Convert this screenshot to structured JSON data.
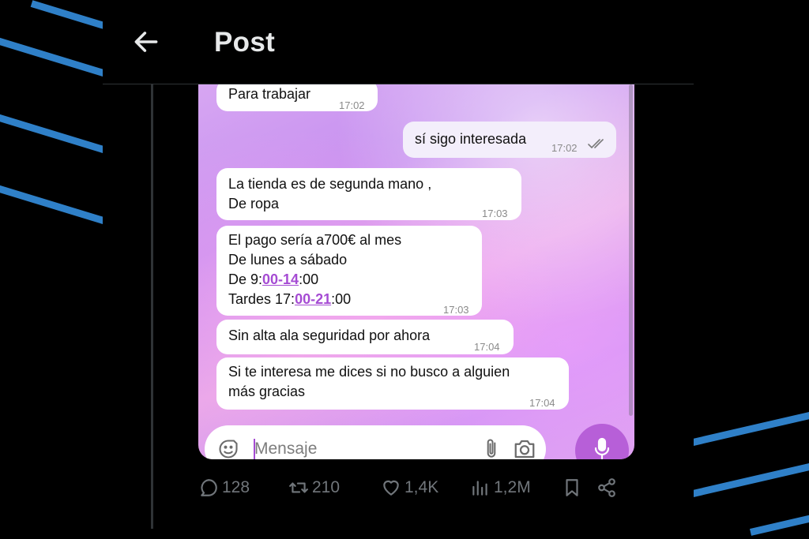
{
  "header": {
    "title": "Post",
    "back_icon": "arrow-left-icon"
  },
  "chat": {
    "messages": [
      {
        "text": "Para trabajar",
        "time": "17:02",
        "direction": "incoming"
      },
      {
        "text": "sí sigo interesada",
        "time": "17:02",
        "direction": "outgoing",
        "status": "read"
      },
      {
        "lines": [
          "La tienda es de  segunda mano ,",
          "De ropa"
        ],
        "time": "17:03",
        "direction": "incoming"
      },
      {
        "lines": [
          "El pago sería a700€ al mes",
          "De lunes a sábado"
        ],
        "schedule": [
          {
            "prefix": "De 9:",
            "link1": "00-14",
            "suffix": ":00"
          },
          {
            "prefix": "Tardes 17:",
            "link1": "00-21",
            "suffix": ":00"
          }
        ],
        "time": "17:03",
        "direction": "incoming"
      },
      {
        "text": "Sin alta ala seguridad por ahora",
        "time": "17:04",
        "direction": "incoming"
      },
      {
        "lines": [
          "Si te interesa me dices si no busco a alguien",
          "más gracias"
        ],
        "time": "17:04",
        "direction": "incoming"
      }
    ],
    "input_placeholder": "Mensaje",
    "accent_color": "#b75fd8"
  },
  "actions": {
    "replies": "128",
    "reposts": "210",
    "likes": "1,4K",
    "views": "1,2M"
  },
  "colors": {
    "background": "#000000",
    "stripes": "#2f80c8",
    "muted": "#71767b"
  }
}
